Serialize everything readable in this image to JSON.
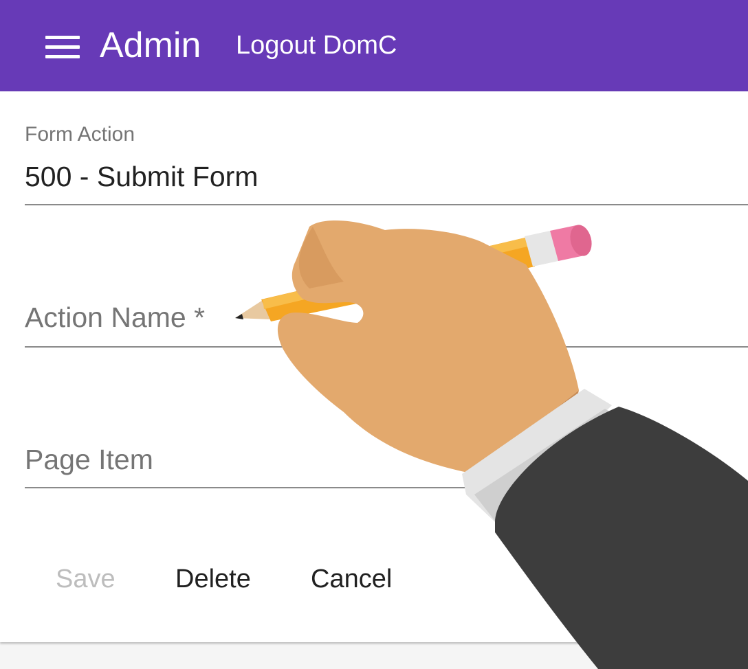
{
  "toolbar": {
    "title": "Admin",
    "logout_label": "Logout DomC",
    "background_color": "#673ab7",
    "menu_icon": "hamburger-menu-icon"
  },
  "form": {
    "form_action": {
      "label": "Form Action",
      "value": "500 - Submit Form"
    },
    "action_name": {
      "placeholder": "Action Name *"
    },
    "page_item": {
      "placeholder": "Page Item"
    }
  },
  "buttons": {
    "save_label": "Save",
    "delete_label": "Delete",
    "cancel_label": "Cancel"
  }
}
